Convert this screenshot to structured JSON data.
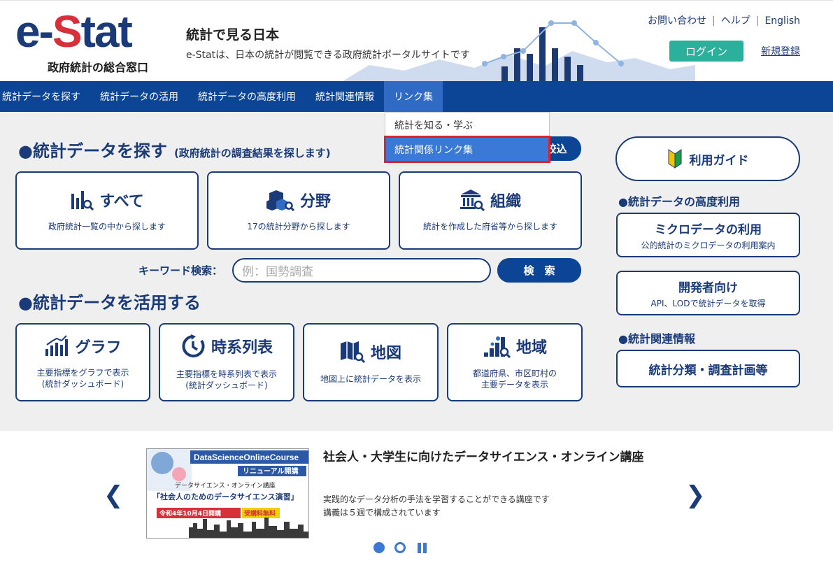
{
  "header": {
    "logo_text_e": "e-",
    "logo_text_s": "S",
    "logo_text_tat": "tat",
    "logo_subtitle": "政府統計の総合窓口",
    "tagline_title": "統計で見る日本",
    "tagline_sub": "e-Statは、日本の統計が閲覧できる政府統計ポータルサイトです",
    "links": [
      "お問い合わせ",
      "ヘルプ",
      "English"
    ],
    "login_label": "ログイン",
    "signup_label": "新規登録",
    "accent_color": "#2ab09b"
  },
  "nav": {
    "items": [
      "統計データを探す",
      "統計データの活用",
      "統計データの高度利用",
      "統計関連情報",
      "リンク集"
    ],
    "active": "リンク集",
    "dropdown": [
      "統計を知る・学ぶ",
      "統計関係リンク集"
    ]
  },
  "search_section": {
    "title": "●統計データを探す",
    "subtitle": "(政府統計の調査結果を探します)",
    "filter_label": "絞込",
    "cards": [
      {
        "title": "すべて",
        "desc": "政府統計一覧の中から探します",
        "icon": "bar-chart-search-icon"
      },
      {
        "title": "分野",
        "desc": "17の統計分野から探します",
        "icon": "boxes-search-icon"
      },
      {
        "title": "組織",
        "desc": "統計を作成した府省等から探します",
        "icon": "building-search-icon"
      }
    ],
    "keyword_label": "キーワード検索：",
    "keyword_placeholder": "例：国勢調査",
    "search_button": "検　索"
  },
  "use_section": {
    "title": "●統計データを活用する",
    "cards": [
      {
        "title": "グラフ",
        "desc1": "主要指標をグラフで表示",
        "desc2": "(統計ダッシュボード)",
        "icon": "graph-icon"
      },
      {
        "title": "時系列表",
        "desc1": "主要指標を時系列表で表示",
        "desc2": "(統計ダッシュボード)",
        "icon": "clock-icon"
      },
      {
        "title": "地図",
        "desc1": "地図上に統計データを表示",
        "desc2": "",
        "icon": "map-search-icon"
      },
      {
        "title": "地域",
        "desc1": "都道府県、市区町村の",
        "desc2": "主要データを表示",
        "icon": "region-chart-icon"
      }
    ]
  },
  "sidebar": {
    "guide_label": "利用ガイド",
    "advanced_head": "●統計データの高度利用",
    "micro_title": "ミクロデータの利用",
    "micro_desc": "公的統計のミクロデータの利用案内",
    "dev_title": "開発者向け",
    "dev_desc": "API、LODで統計データを取得",
    "related_head": "●統計関連情報",
    "classification_label": "統計分類・調査計画等"
  },
  "banner": {
    "title": "社会人・大学生に向けたデータサイエンス・オンライン講座",
    "desc1": "実践的なデータ分析の手法を学習することができる講座です",
    "desc2": "講義は５週で構成されています",
    "img_course": "DataScienceOnlineCourse",
    "img_renewal": "リニューアル開講",
    "img_sub": "データサイエンス・オンライン講座",
    "img_main": "「社会人のためのデータサイエンス演習」",
    "img_date": "令和4年10月4日開講",
    "img_free": "受講料無料"
  }
}
